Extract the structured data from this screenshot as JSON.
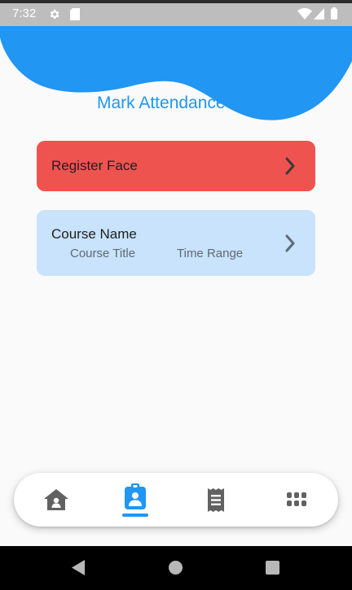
{
  "status_bar": {
    "time": "7:32",
    "icons": [
      "settings-icon",
      "sd-card-icon",
      "wifi-icon",
      "signal-icon",
      "battery-icon"
    ]
  },
  "header": {
    "title": "Mark Attendance",
    "blob_color": "#2196f3"
  },
  "register_card": {
    "label": "Register Face",
    "color": "#ef5350",
    "icon": "chevron-right-icon"
  },
  "course_card": {
    "name": "Course Name",
    "title": "Course Title",
    "time_range": "Time Range",
    "color": "#c8e3fb",
    "icon": "chevron-right-icon"
  },
  "bottom_nav": {
    "items": [
      {
        "icon": "home-icon",
        "active": false
      },
      {
        "icon": "badge-icon",
        "active": true
      },
      {
        "icon": "receipt-icon",
        "active": false
      },
      {
        "icon": "apps-grid-icon",
        "active": false
      }
    ],
    "active_color": "#2196f3",
    "inactive_color": "#616161"
  },
  "system_nav": {
    "buttons": [
      "back-icon",
      "home-circle-icon",
      "recents-icon"
    ]
  }
}
